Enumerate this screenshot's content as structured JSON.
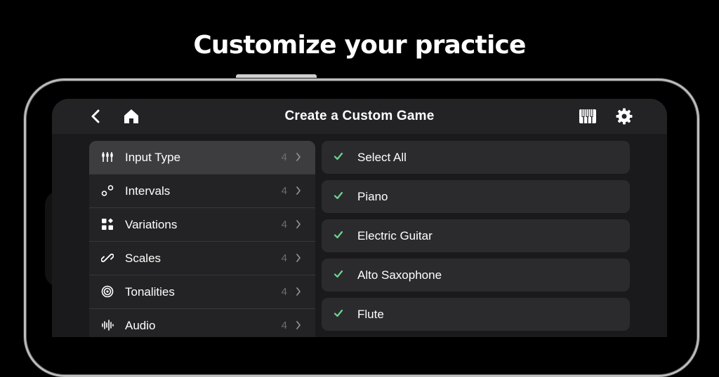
{
  "headline": "Customize your practice",
  "header": {
    "title": "Create a Custom Game",
    "icons": [
      "back-icon",
      "home-icon",
      "piano-keys-icon",
      "gear-icon"
    ]
  },
  "menu": {
    "items": [
      {
        "label": "Input Type",
        "count": "4",
        "icon": "input-type-icon",
        "active": true
      },
      {
        "label": "Intervals",
        "count": "4",
        "icon": "intervals-icon"
      },
      {
        "label": "Variations",
        "count": "4",
        "icon": "variations-icon"
      },
      {
        "label": "Scales",
        "count": "4",
        "icon": "scales-icon"
      },
      {
        "label": "Tonalities",
        "count": "4",
        "icon": "tonalities-icon"
      },
      {
        "label": "Audio",
        "count": "4",
        "icon": "audio-icon"
      }
    ]
  },
  "options": {
    "items": [
      {
        "label": "Select All",
        "checked": true
      },
      {
        "label": "Piano",
        "checked": true
      },
      {
        "label": "Electric Guitar",
        "checked": true
      },
      {
        "label": "Alto Saxophone",
        "checked": true
      },
      {
        "label": "Flute",
        "checked": true
      }
    ]
  },
  "colors": {
    "accent_check": "#6fd68f",
    "background": "#000000",
    "panel": "#232325",
    "active_row": "#3d3d40"
  }
}
